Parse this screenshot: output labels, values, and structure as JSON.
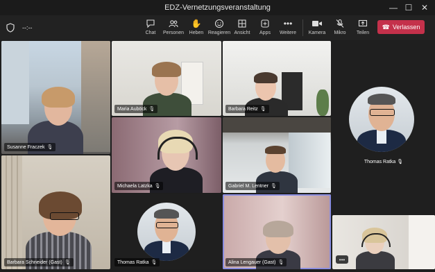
{
  "window": {
    "title": "EDZ-Vernetzungsveranstaltung",
    "timer": "--:--"
  },
  "toolbar": {
    "chat": "Chat",
    "people": "Personen",
    "raise": "Heben",
    "react": "Reagieren",
    "view": "Ansicht",
    "apps": "Apps",
    "more": "Weitere",
    "camera": "Kamera",
    "mic": "Mikro",
    "share": "Teilen",
    "leave": "Verlassen"
  },
  "participants": [
    {
      "name": "Susanne Fraczek"
    },
    {
      "name": "Maria Auböck"
    },
    {
      "name": "Barbara Reitz"
    },
    {
      "name": "Thomas Ratka"
    },
    {
      "name": "Michaela Latzka"
    },
    {
      "name": "Gabriel M. Lentner"
    },
    {
      "name": "Barbara Schneider (Gast)"
    },
    {
      "name": "Thomas Ratka"
    },
    {
      "name": "Alina Lengauer (Gast)"
    },
    {
      "name": ""
    }
  ],
  "overflow_label": "•••",
  "colors": {
    "leave": "#c4314b",
    "active_border": "#8a8de0",
    "background": "#1f1f1f"
  }
}
